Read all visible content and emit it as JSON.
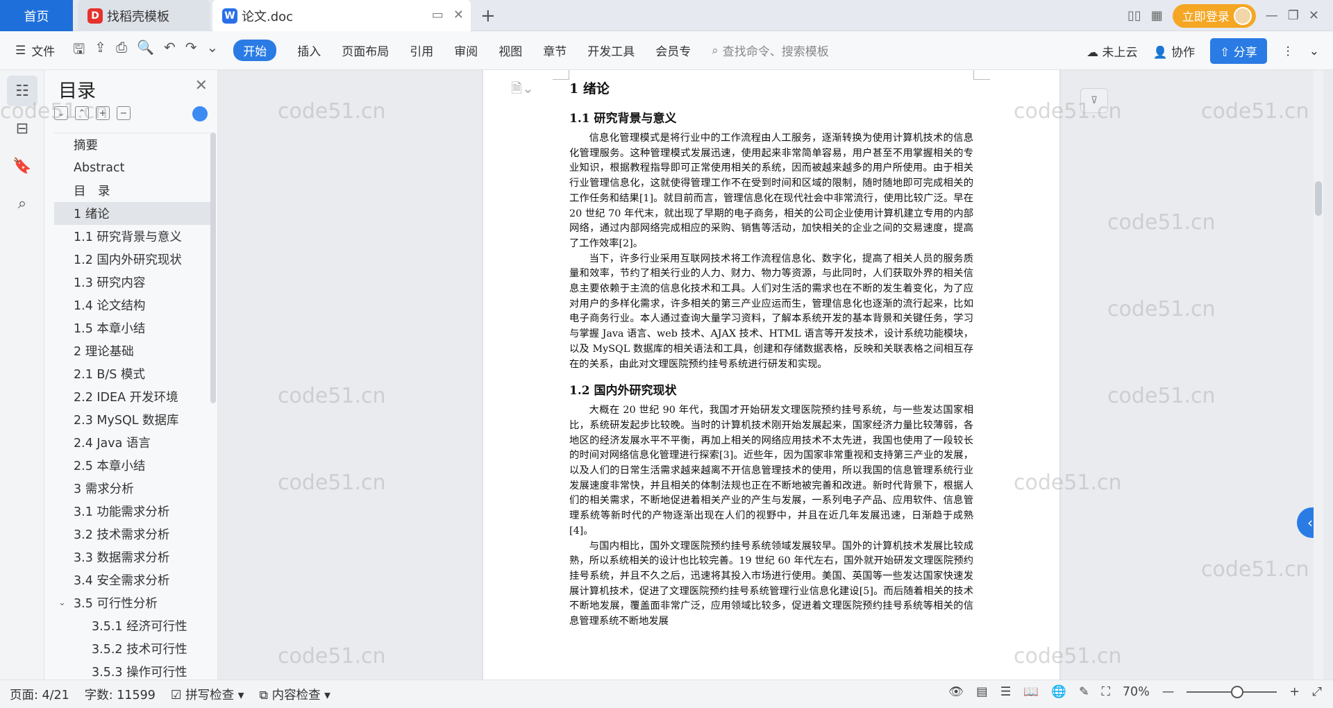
{
  "tabbar": {
    "home_label": "首页",
    "tab1_label": "找稻壳模板",
    "tab2_label": "论文.doc",
    "login_label": "立即登录"
  },
  "toolbar": {
    "file_label": "文件",
    "tabs": [
      "开始",
      "插入",
      "页面布局",
      "引用",
      "审阅",
      "视图",
      "章节",
      "开发工具",
      "会员专"
    ],
    "search_placeholder": "查找命令、搜索模板",
    "cloud_label": "未上云",
    "collab_label": "协作",
    "share_label": "分享"
  },
  "toc": {
    "title": "目录",
    "items": [
      "摘要",
      "Abstract",
      "目　录",
      "1 绪论",
      "1.1 研究背景与意义",
      "1.2 国内外研究现状",
      "1.3 研究内容",
      "1.4 论文结构",
      "1.5 本章小结",
      "2 理论基础",
      "2.1 B/S 模式",
      "2.2 IDEA 开发环境",
      "2.3 MySQL 数据库",
      "2.4 Java 语言",
      "2.5 本章小结",
      "3 需求分析",
      "3.1 功能需求分析",
      "3.2 技术需求分析",
      "3.3 数据需求分析",
      "3.4 安全需求分析",
      "3.5 可行性分析",
      "3.5.1 经济可行性",
      "3.5.2 技术可行性",
      "3.5.3 操作可行性"
    ]
  },
  "document": {
    "h1": "1 绪论",
    "h2_1": "1.1 研究背景与意义",
    "p1": "信息化管理模式是将行业中的工作流程由人工服务，逐渐转换为使用计算机技术的信息化管理服务。这种管理模式发展迅速，使用起来非常简单容易，用户甚至不用掌握相关的专业知识，根据教程指导即可正常使用相关的系统，因而被越来越多的用户所使用。由于相关行业管理信息化，这就使得管理工作不在受到时间和区域的限制，随时随地即可完成相关的工作任务和结果[1]。就目前而言，管理信息化在现代社会中非常流行，使用比较广泛。早在 20 世纪 70 年代末，就出现了早期的电子商务，相关的公司企业使用计算机建立专用的内部网络，通过内部网络完成相应的采购、销售等活动，加快相关的企业之间的交易速度，提高了工作效率[2]。",
    "p2": "当下，许多行业采用互联网技术将工作流程信息化、数字化，提高了相关人员的服务质量和效率，节约了相关行业的人力、财力、物力等资源，与此同时，人们获取外界的相关信息主要依赖于主流的信息化技术和工具。人们对生活的需求也在不断的发生着变化，为了应对用户的多样化需求，许多相关的第三产业应运而生，管理信息化也逐渐的流行起来，比如电子商务行业。本人通过查询大量学习资料，了解本系统开发的基本背景和关键任务，学习与掌握 Java 语言、web 技术、AJAX 技术、HTML 语言等开发技术，设计系统功能模块，以及 MySQL 数据库的相关语法和工具，创建和存储数据表格，反映和关联表格之间相互存在的关系，由此对文理医院预约挂号系统进行研发和实现。",
    "h2_2": "1.2 国内外研究现状",
    "p3": "大概在 20 世纪 90 年代，我国才开始研发文理医院预约挂号系统，与一些发达国家相比，系统研发起步比较晚。当时的计算机技术刚开始发展起来，国家经济力量比较薄弱，各地区的经济发展水平不平衡，再加上相关的网络应用技术不太先进，我国也使用了一段较长的时间对网络信息化管理进行探索[3]。近些年，因为国家非常重视和支持第三产业的发展，以及人们的日常生活需求越来越离不开信息管理技术的使用，所以我国的信息管理系统行业发展速度非常快，并且相关的体制法规也正在不断地被完善和改进。新时代背景下，根据人们的相关需求，不断地促进着相关产业的产生与发展，一系列电子产品、应用软件、信息管理系统等新时代的产物逐渐出现在人们的视野中，并且在近几年发展迅速，日渐趋于成熟[4]。",
    "p4": "与国内相比，国外文理医院预约挂号系统领域发展较早。国外的计算机技术发展比较成熟，所以系统相关的设计也比较完善。19 世纪 60 年代左右，国外就开始研发文理医院预约挂号系统，并且不久之后，迅速将其投入市场进行使用。美国、英国等一些发达国家快速发展计算机技术，促进了文理医院预约挂号系统管理行业信息化建设[5]。而后随着相关的技术不断地发展，覆盖面非常广泛，应用领域比较多，促进着文理医院预约挂号系统等相关的信息管理系统不断地发展"
  },
  "watermark_text": "code51.cn",
  "statusbar": {
    "page": "页面: 4/21",
    "words": "字数: 11599",
    "spell": "拼写检查",
    "content_check": "内容检查",
    "zoom": "70%"
  },
  "colors": {
    "accent": "#2a7be4",
    "home_tab": "#1e6fd9",
    "login": "#f5a623"
  }
}
